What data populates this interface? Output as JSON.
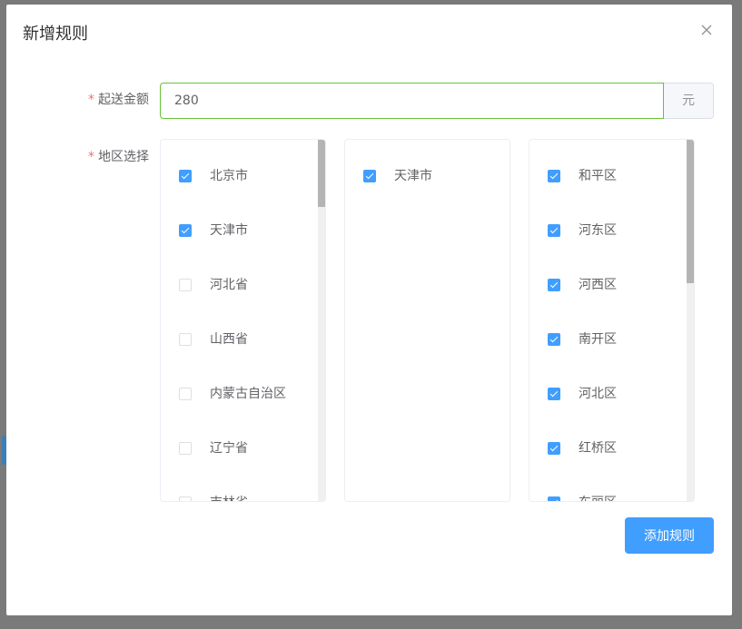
{
  "dialog": {
    "title": "新增规则",
    "close_icon": "close-icon"
  },
  "form": {
    "amount": {
      "required_mark": "*",
      "label": "起送金额",
      "value": "280",
      "unit": "元"
    },
    "region": {
      "required_mark": "*",
      "label": "地区选择"
    }
  },
  "provinces": [
    {
      "label": "北京市",
      "checked": true
    },
    {
      "label": "天津市",
      "checked": true
    },
    {
      "label": "河北省",
      "checked": false
    },
    {
      "label": "山西省",
      "checked": false
    },
    {
      "label": "内蒙古自治区",
      "checked": false
    },
    {
      "label": "辽宁省",
      "checked": false
    },
    {
      "label": "吉林省",
      "checked": false
    }
  ],
  "cities": [
    {
      "label": "天津市",
      "checked": true
    }
  ],
  "districts": [
    {
      "label": "和平区",
      "checked": true
    },
    {
      "label": "河东区",
      "checked": true
    },
    {
      "label": "河西区",
      "checked": true
    },
    {
      "label": "南开区",
      "checked": true
    },
    {
      "label": "河北区",
      "checked": true
    },
    {
      "label": "红桥区",
      "checked": true
    },
    {
      "label": "东丽区",
      "checked": true
    }
  ],
  "actions": {
    "add_label": "添加规则"
  },
  "colors": {
    "primary": "#409eff",
    "success_border": "#67c23a",
    "required": "#f56c6c"
  }
}
